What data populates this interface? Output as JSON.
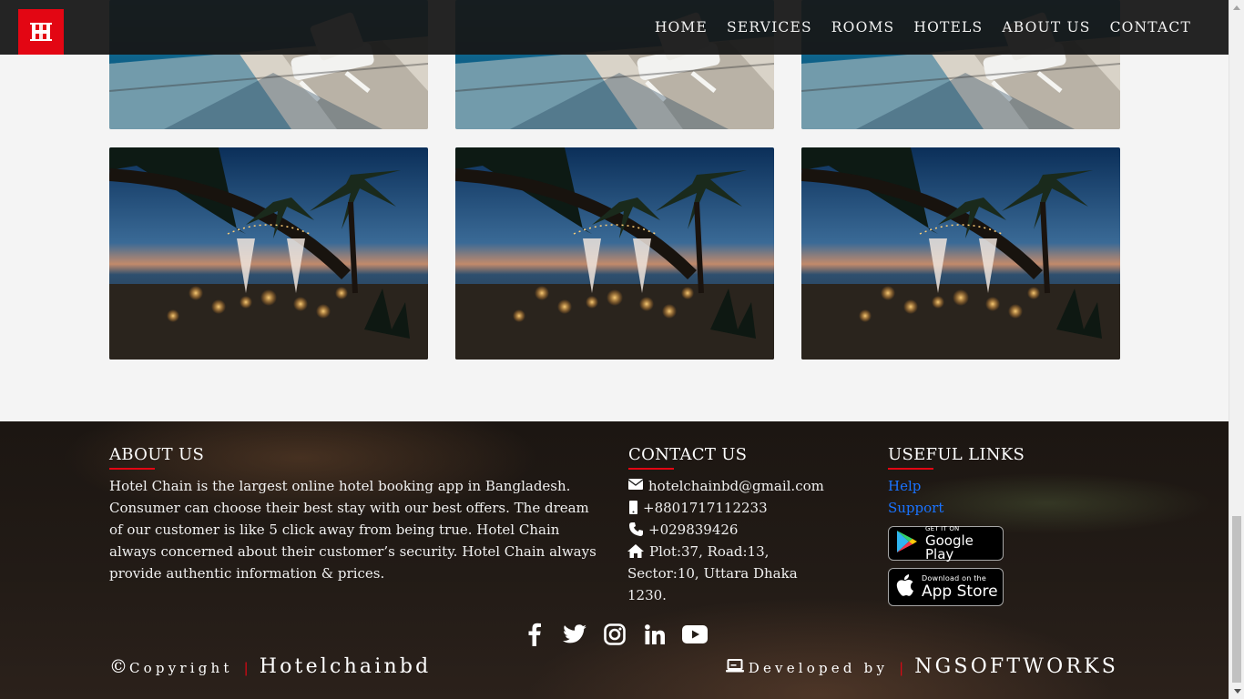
{
  "nav": {
    "logo_letter": "H",
    "links": [
      "HOME",
      "SERVICES",
      "ROOMS",
      "HOTELS",
      "ABOUT US",
      "CONTACT"
    ]
  },
  "footer": {
    "about": {
      "heading": "ABOUT US",
      "text": "Hotel Chain is the largest online hotel booking app in Bangladesh. Consumer can choose their best stay with our best offers. The dream of our customer is like 5 click away from being true. Hotel Chain always concerned about their customer’s security. Hotel Chain always provide authentic information & prices."
    },
    "contact": {
      "heading": "CONTACT US",
      "email": "hotelchainbd@gmail.com",
      "mobile": "+8801717112233",
      "phone": "+029839426",
      "address": "Plot:37, Road:13, Sector:10, Uttara Dhaka 1230."
    },
    "links": {
      "heading": "USEFUL LINKS",
      "items": [
        "Help",
        "Support"
      ],
      "google_play": {
        "small": "GET IT ON",
        "big": "Google Play"
      },
      "app_store": {
        "small": "Download on the",
        "big": "App Store"
      }
    },
    "copyright": {
      "symbol": "©",
      "label": "Copyright",
      "separator": "|",
      "brand": "Hotelchainbd"
    },
    "developed": {
      "label": "Developed by",
      "separator": "|",
      "company": "NGSOFTWORKS"
    }
  },
  "colors": {
    "accent": "#e30613",
    "link": "#1a73ff",
    "navbar": "#161616"
  }
}
